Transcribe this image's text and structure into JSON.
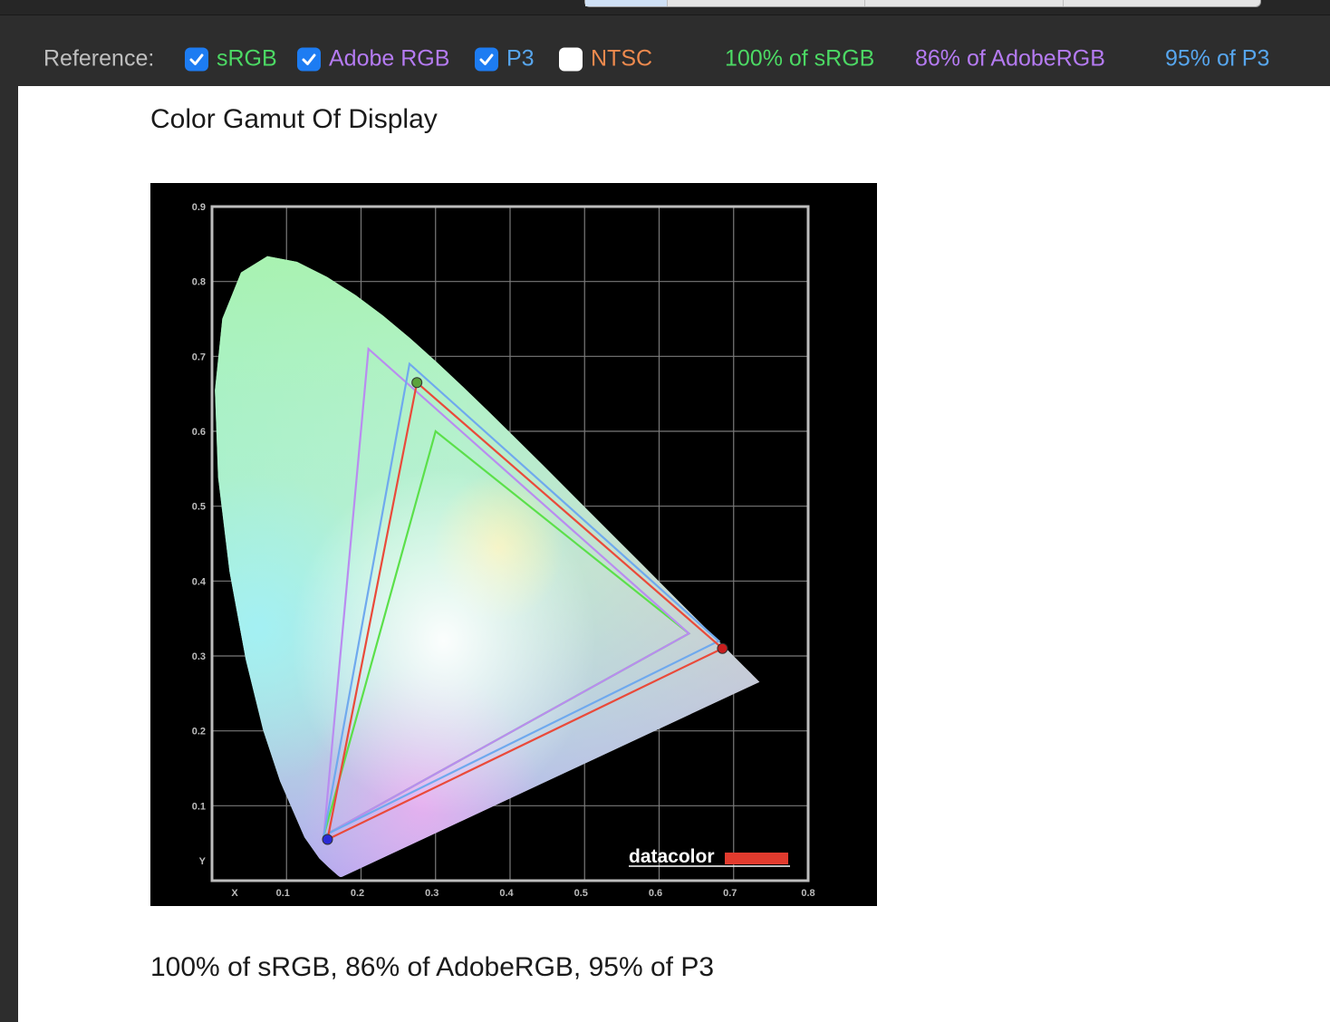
{
  "reference_bar": {
    "label": "Reference:",
    "checkboxes": [
      {
        "label": "sRGB",
        "checked": true,
        "color": "#4cd964"
      },
      {
        "label": "Adobe RGB",
        "checked": true,
        "color": "#b57bf2"
      },
      {
        "label": "P3",
        "checked": true,
        "color": "#57a6ee"
      },
      {
        "label": "NTSC",
        "checked": false,
        "color": "#ee8a4e"
      }
    ],
    "coverage": [
      {
        "text": "100% of sRGB",
        "color": "#4cd964"
      },
      {
        "text": "86% of AdobeRGB",
        "color": "#b57bf2"
      },
      {
        "text": "95% of P3",
        "color": "#57a6ee"
      }
    ]
  },
  "content": {
    "title": "Color Gamut Of Display",
    "caption": "100% of sRGB, 86% of AdobeRGB, 95% of P3"
  },
  "chart_data": {
    "type": "scatter",
    "x_tick_labels": [
      "X",
      "0.1",
      "0.2",
      "0.3",
      "0.4",
      "0.5",
      "0.6",
      "0.7",
      "0.8"
    ],
    "y_tick_labels": [
      "Y",
      "0.1",
      "0.2",
      "0.3",
      "0.4",
      "0.5",
      "0.6",
      "0.7",
      "0.8",
      "0.9"
    ],
    "xlim": [
      0,
      0.8
    ],
    "ylim": [
      0,
      0.9
    ],
    "grid": true,
    "logo": "datacolor",
    "gamuts": [
      {
        "name": "sRGB",
        "color": "#5be04a",
        "points": [
          [
            0.64,
            0.33
          ],
          [
            0.3,
            0.6
          ],
          [
            0.15,
            0.06
          ]
        ]
      },
      {
        "name": "Adobe RGB",
        "color": "#b98cf0",
        "points": [
          [
            0.64,
            0.33
          ],
          [
            0.21,
            0.71
          ],
          [
            0.15,
            0.06
          ]
        ]
      },
      {
        "name": "P3",
        "color": "#6fa9ee",
        "points": [
          [
            0.68,
            0.32
          ],
          [
            0.265,
            0.69
          ],
          [
            0.15,
            0.06
          ]
        ]
      },
      {
        "name": "Display",
        "color": "#ea4a3a",
        "points": [
          [
            0.685,
            0.31
          ],
          [
            0.275,
            0.665
          ],
          [
            0.155,
            0.055
          ]
        ]
      }
    ],
    "measured_points": [
      {
        "x": 0.685,
        "y": 0.31,
        "color": "#c81e1e"
      },
      {
        "x": 0.275,
        "y": 0.665,
        "color": "#5aa33c"
      },
      {
        "x": 0.155,
        "y": 0.055,
        "color": "#2a2ad6"
      }
    ]
  }
}
